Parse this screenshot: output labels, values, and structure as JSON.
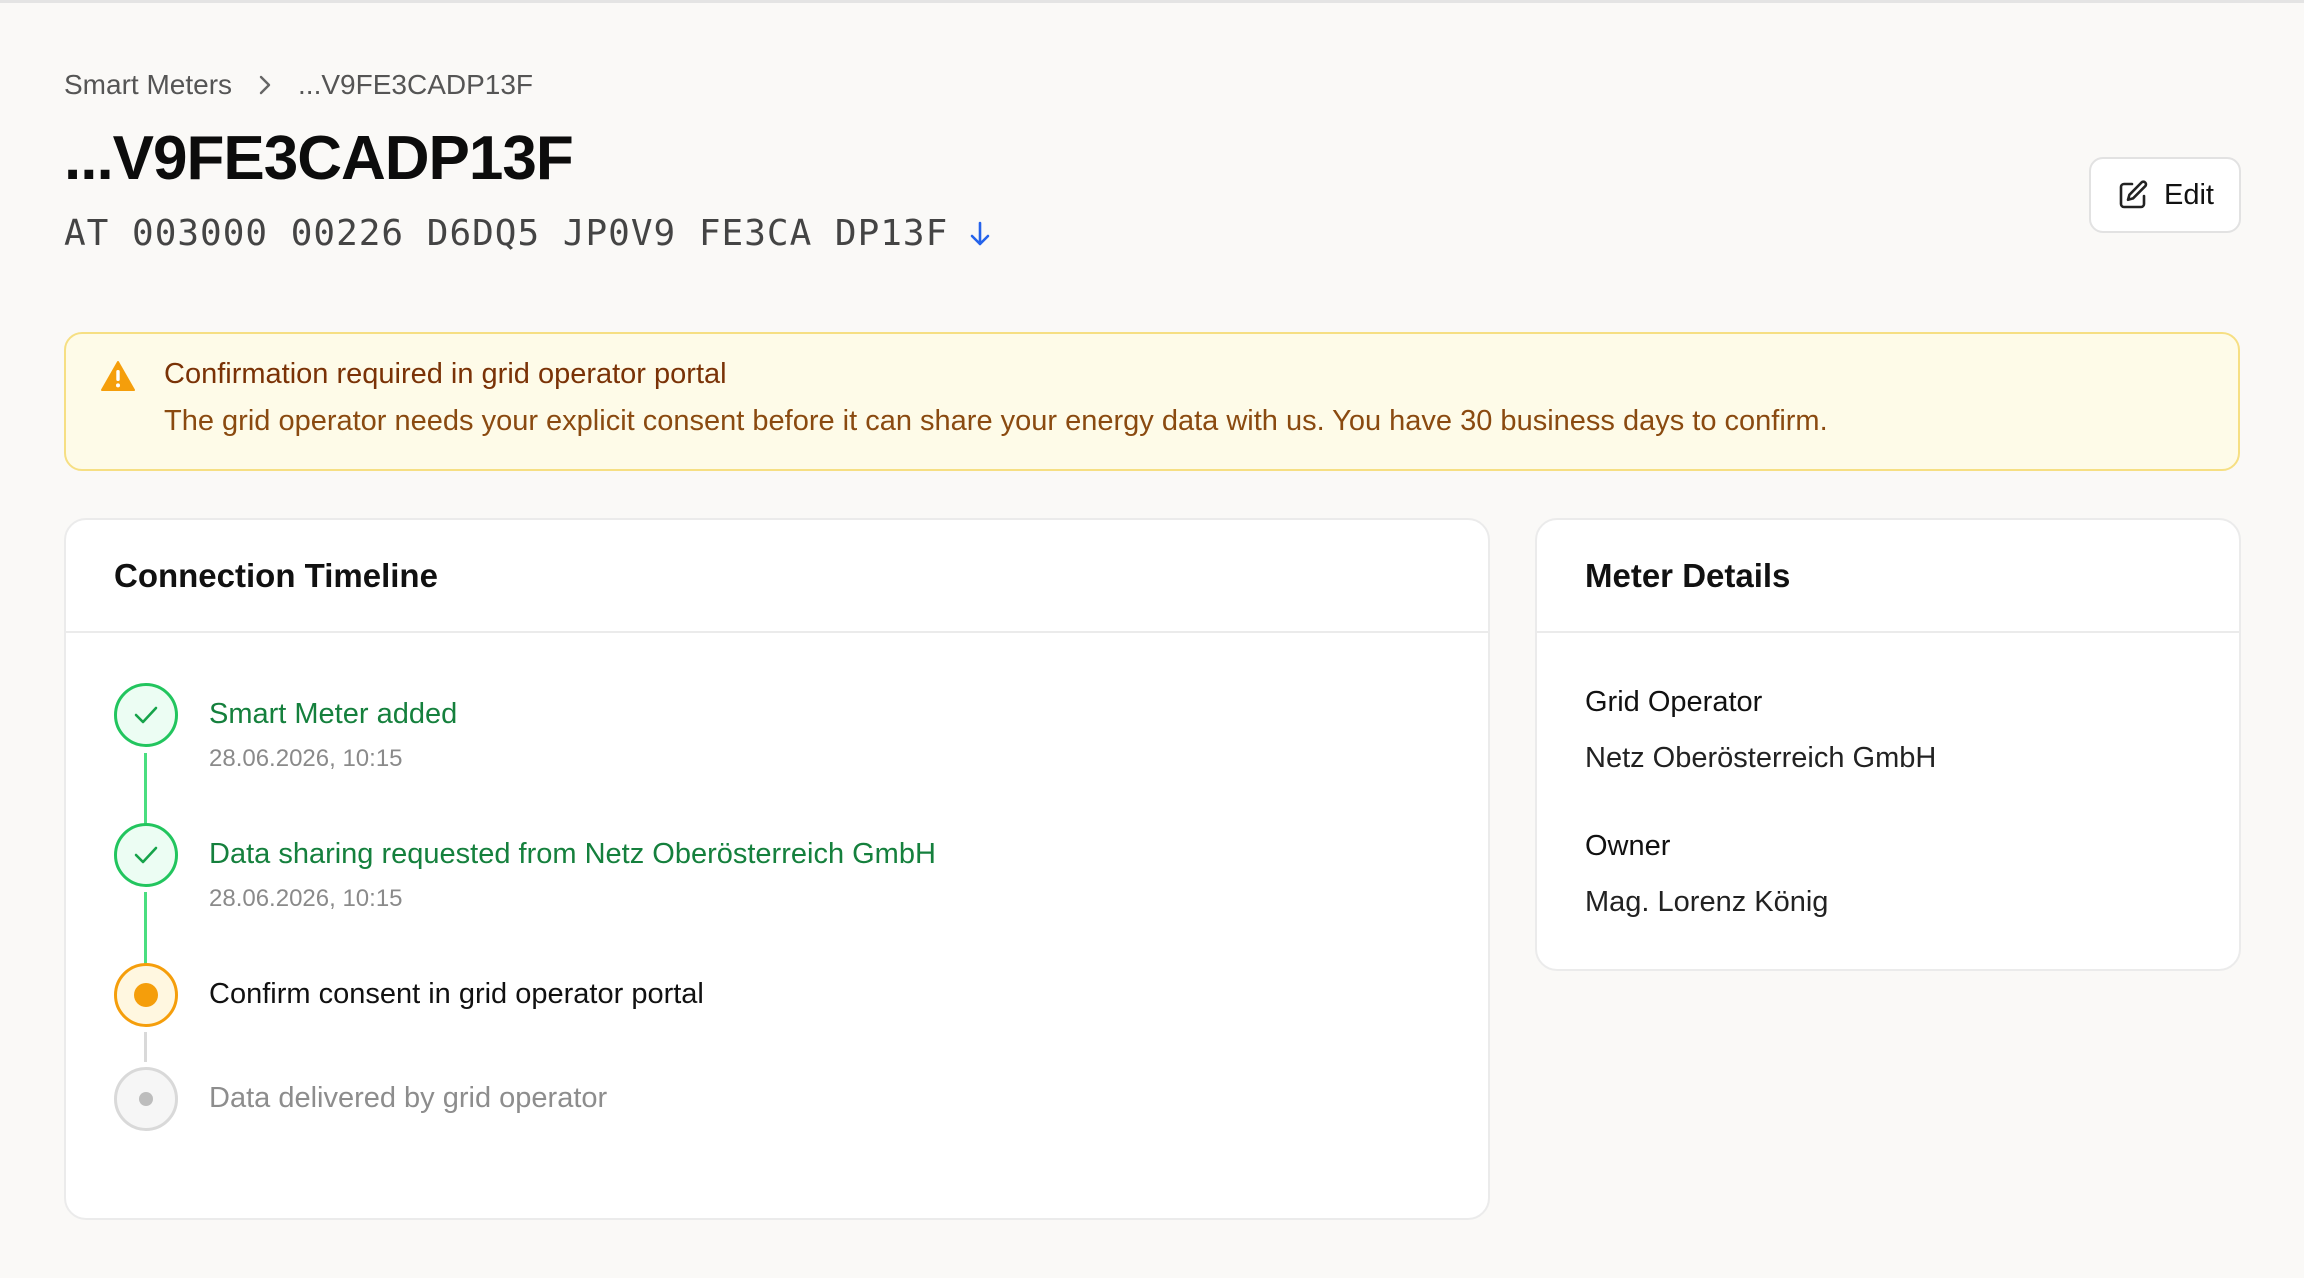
{
  "breadcrumb": {
    "root": "Smart Meters",
    "current": "...V9FE3CADP13F"
  },
  "header": {
    "title": "...V9FE3CADP13F",
    "meter_id": "AT 003000 00226 D6DQ5 JP0V9 FE3CA DP13F",
    "edit_label": "Edit"
  },
  "alert": {
    "title": "Confirmation required in grid operator portal",
    "body": "The grid operator needs your explicit consent before it can share your energy data with us. You have 30 business days to confirm."
  },
  "timeline": {
    "title": "Connection Timeline",
    "steps": [
      {
        "title": "Smart Meter added",
        "time": "28.06.2026, 10:15",
        "status": "done"
      },
      {
        "title": "Data sharing requested from Netz Oberösterreich GmbH",
        "time": "28.06.2026, 10:15",
        "status": "done"
      },
      {
        "title": "Confirm consent in grid operator portal",
        "status": "current"
      },
      {
        "title": "Data delivered by grid operator",
        "status": "pending"
      }
    ]
  },
  "details": {
    "title": "Meter Details",
    "grid_operator_label": "Grid Operator",
    "grid_operator_value": "Netz Oberösterreich GmbH",
    "owner_label": "Owner",
    "owner_value": "Mag. Lorenz König"
  },
  "colors": {
    "done": "#22c55e",
    "current": "#f59e0b",
    "pending": "#d9d9d9",
    "warning": "#f59e0b",
    "link_blue": "#2563eb"
  },
  "icons": {
    "breadcrumb_separator": "chevron-right-icon",
    "download": "arrow-down-icon",
    "edit": "pencil-square-icon",
    "alert": "warning-triangle-icon",
    "step_done": "check-icon"
  }
}
